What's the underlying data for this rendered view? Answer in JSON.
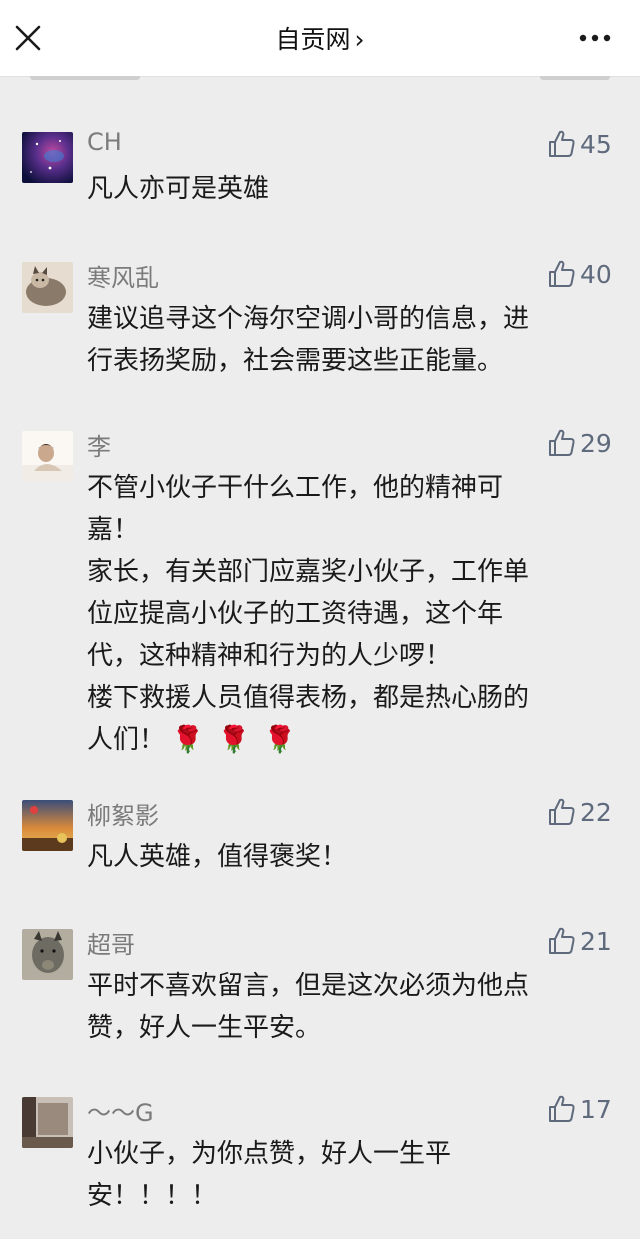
{
  "header": {
    "title": "自贡网",
    "title_chevron": "›",
    "close_icon": "close-icon",
    "more_icon": "more-icon"
  },
  "comments": [
    {
      "author": "CH",
      "likes": "45",
      "text": "凡人亦可是英雄",
      "avatar_colors": [
        "#0c0f3a",
        "#5a2f8c",
        "#c04aa0",
        "#3c7fd6"
      ]
    },
    {
      "author": "寒风乱",
      "likes": "40",
      "text": "建议追寻这个海尔空调小哥的信息，进\n行表扬奖励，社会需要这些正能量。",
      "avatar_colors": [
        "#8a7a6a",
        "#c9b9a4",
        "#5a4c40",
        "#e6ddd0"
      ]
    },
    {
      "author": "李",
      "likes": "29",
      "text": "不管小伙子干什么工作，他的精神可\n嘉！\n家长，有关部门应嘉奖小伙子，工作单\n位应提高小伙子的工资待遇，这个年\n代，这种精神和行为的人少啰！\n楼下救援人员值得表杨，都是热心肠的\n人们！",
      "emoji": "🌹",
      "avatar_colors": [
        "#f2ece6",
        "#d9c7b6",
        "#c9a88d",
        "#fbf7f2"
      ]
    },
    {
      "author": "柳絮影",
      "likes": "22",
      "text": "凡人英雄，值得褒奖！",
      "avatar_colors": [
        "#3a4d7a",
        "#d98a3a",
        "#e8c25a",
        "#5b3a1e"
      ]
    },
    {
      "author": "超哥",
      "likes": "21",
      "text": "平时不喜欢留言，但是这次必须为他点\n赞，好人一生平安。",
      "avatar_colors": [
        "#6e6b63",
        "#b3ada0",
        "#3a3833",
        "#8d8778"
      ]
    },
    {
      "author": "～～G",
      "likes": "17",
      "text": "小伙子，为你点赞，好人一生平\n安！！！！",
      "avatar_colors": [
        "#4a3a34",
        "#9a8a7e",
        "#c8c0b6",
        "#6a5a4e"
      ]
    }
  ],
  "colors": {
    "background": "#ededed",
    "name": "#7b7b7b",
    "text": "#1a1a1a",
    "like": "#5f6a7d"
  }
}
